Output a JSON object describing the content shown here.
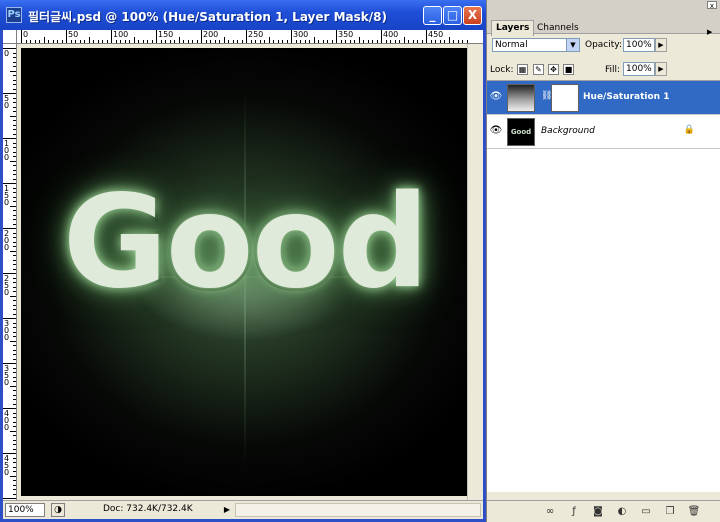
{
  "document": {
    "title": "필터글씨.psd @ 100% (Hue/Saturation 1, Layer Mask/8)",
    "canvas_text": "Good",
    "ruler_h_labels": [
      "0",
      "50",
      "100",
      "150",
      "200",
      "250",
      "300",
      "350",
      "400",
      "450"
    ],
    "ruler_v_labels": [
      "0",
      "50",
      "100",
      "150",
      "200",
      "250",
      "300",
      "350",
      "400",
      "450"
    ],
    "status": {
      "zoom": "100%",
      "doc_info": "Doc: 732.4K/732.4K"
    },
    "window_buttons": {
      "minimize": "_",
      "maximize": "□",
      "close": "X"
    }
  },
  "palette": {
    "tabs": [
      "Layers",
      "Channels"
    ],
    "blend_mode": "Normal",
    "opacity_label": "Opacity:",
    "opacity_value": "100%",
    "lock_label": "Lock:",
    "fill_label": "Fill:",
    "fill_value": "100%",
    "layers": [
      {
        "name": "Hue/Saturation 1",
        "selected": true,
        "type": "adjustment"
      },
      {
        "name": "Background",
        "selected": false,
        "type": "background",
        "thumb_text": "Good"
      }
    ]
  },
  "colors": {
    "titlebar": "#1f4fd8",
    "selection": "#316ac5",
    "canvas_bg": "#000000",
    "glow": "#a6d8a0"
  }
}
